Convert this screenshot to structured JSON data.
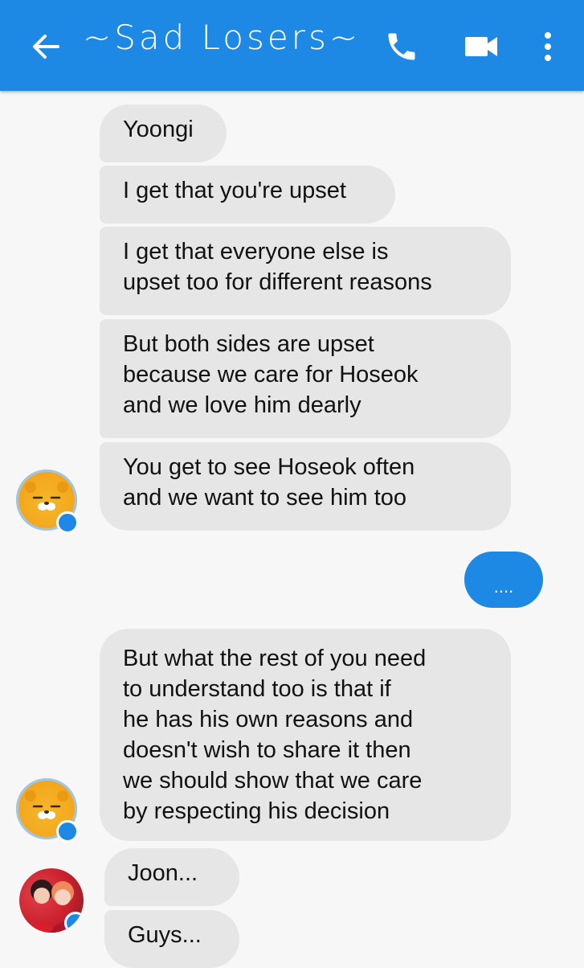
{
  "header": {
    "title": "~Sad Losers~",
    "back_icon": "arrow-left-icon",
    "call_icon": "phone-icon",
    "video_icon": "video-camera-icon",
    "more_icon": "more-vertical-icon",
    "bar_color": "#1e88e5"
  },
  "messages": {
    "group1": [
      [
        "Yoongi"
      ],
      [
        "I get that you're upset"
      ],
      [
        "I get that everyone else is",
        "upset too for different reasons"
      ],
      [
        "But both sides are upset",
        "because we care for Hoseok",
        "and we love him dearly"
      ],
      [
        "You get to see Hoseok often",
        "and we want to see him too"
      ]
    ],
    "mine": "....",
    "group2": [
      [
        "But what the rest of you need",
        "to understand too is that if",
        "he has his own reasons and",
        "doesn't wish to share it then",
        "we should show that we care",
        "by respecting his decision"
      ]
    ],
    "group3": [
      [
        "Joon..."
      ],
      [
        "Guys..."
      ]
    ]
  },
  "colors": {
    "incoming_bubble": "#e6e6e6",
    "outgoing_bubble": "#1e88e5",
    "background": "#f7f7f7"
  }
}
